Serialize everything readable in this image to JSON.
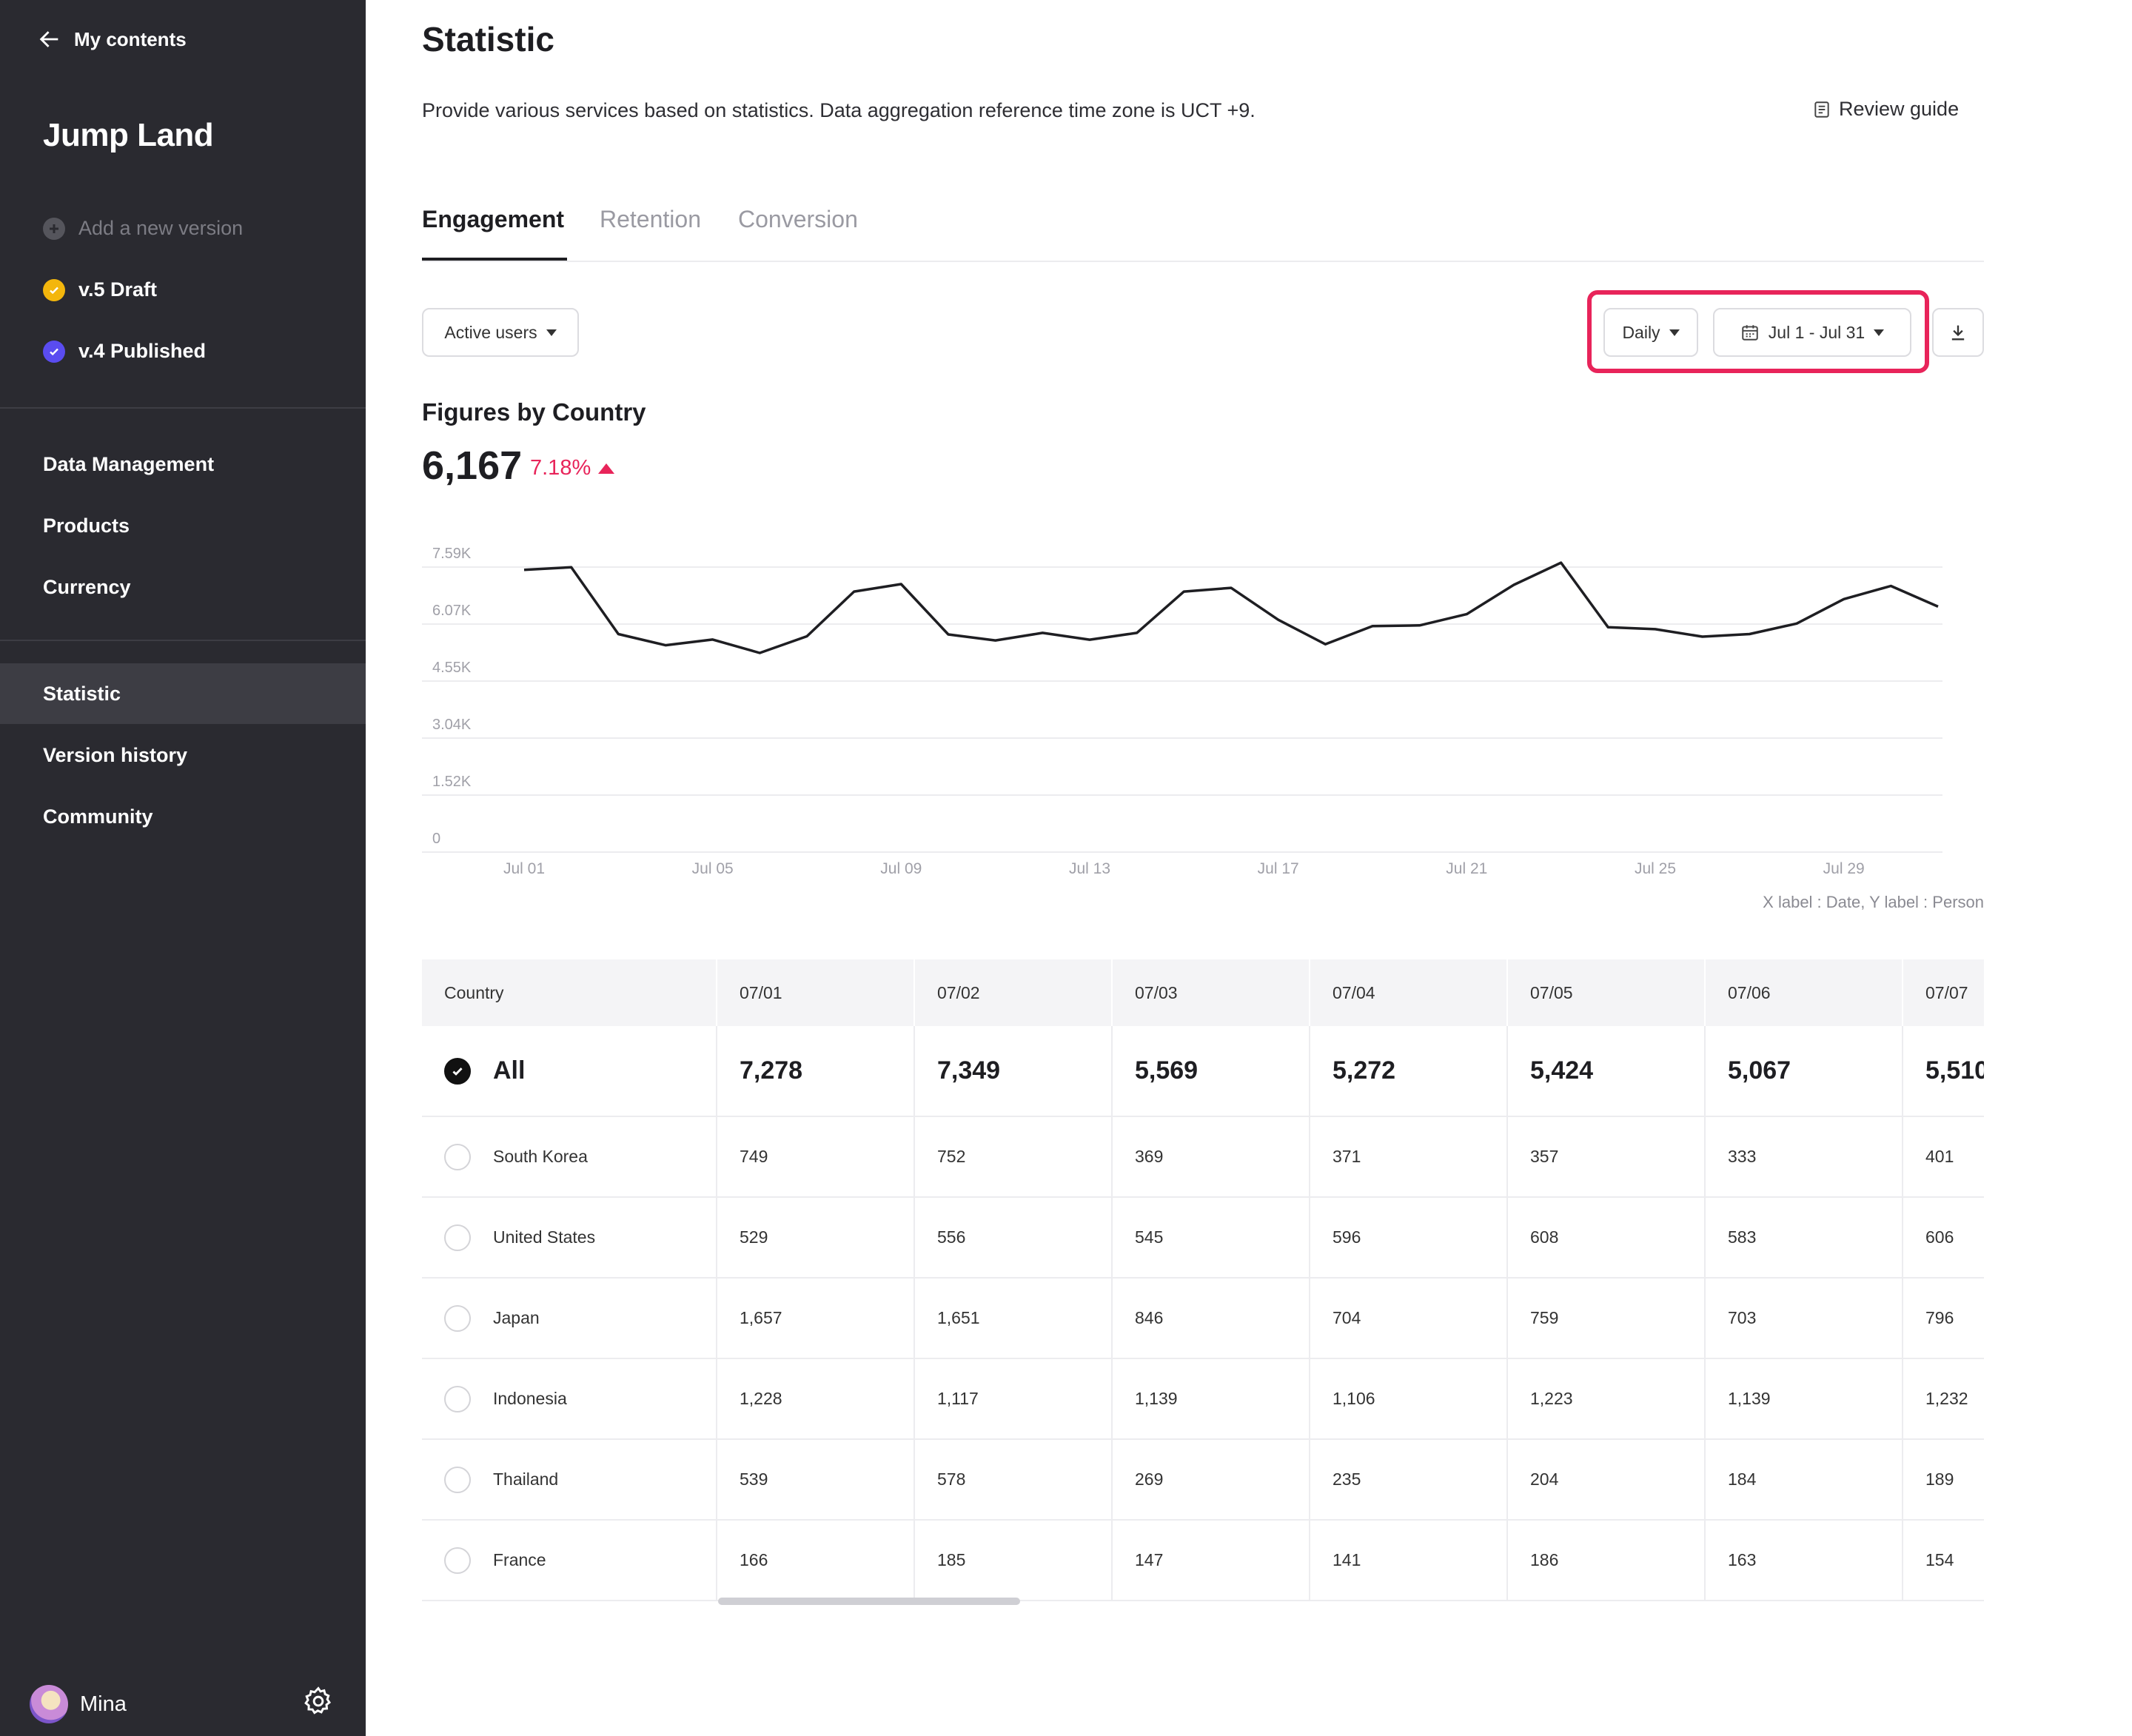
{
  "sidebar": {
    "back_label": "My contents",
    "project_title": "Jump Land",
    "versions": [
      {
        "label": "Add a new version"
      },
      {
        "label": "v.5 Draft",
        "color": "#f3b60c"
      },
      {
        "label": "v.4 Published",
        "color": "#5a4cf0"
      }
    ],
    "nav_primary": [
      {
        "label": "Data Management"
      },
      {
        "label": "Products"
      },
      {
        "label": "Currency"
      }
    ],
    "nav_secondary": [
      {
        "label": "Statistic",
        "active": true
      },
      {
        "label": "Version history"
      },
      {
        "label": "Community"
      }
    ],
    "user": {
      "name": "Mina"
    }
  },
  "header": {
    "title": "Statistic",
    "description": "Provide various services based on statistics. Data aggregation reference time zone is UCT +9.",
    "review_guide": "Review guide"
  },
  "tabs": [
    {
      "label": "Engagement",
      "active": true
    },
    {
      "label": "Retention"
    },
    {
      "label": "Conversion"
    }
  ],
  "filters": {
    "metric": "Active users",
    "granularity": "Daily",
    "date_range": "Jul 1 - Jul 31"
  },
  "summary": {
    "title": "Figures by Country",
    "total": "6,167",
    "change": "7.18%"
  },
  "chart_data": {
    "type": "line",
    "x": [
      "Jul 01",
      "Jul 02",
      "Jul 03",
      "Jul 04",
      "Jul 05",
      "Jul 06",
      "Jul 07",
      "Jul 08",
      "Jul 09",
      "Jul 10",
      "Jul 11",
      "Jul 12",
      "Jul 13",
      "Jul 14",
      "Jul 15",
      "Jul 16",
      "Jul 17",
      "Jul 18",
      "Jul 19",
      "Jul 20",
      "Jul 21",
      "Jul 22",
      "Jul 23",
      "Jul 24",
      "Jul 25",
      "Jul 26",
      "Jul 27",
      "Jul 28",
      "Jul 29",
      "Jul 30",
      "Jul 31"
    ],
    "series": [
      {
        "values": [
          7278,
          7349,
          5569,
          5272,
          5424,
          5067,
          5510,
          6700,
          6900,
          5560,
          5400,
          5600,
          5420,
          5600,
          6700,
          6800,
          5950,
          5300,
          5780,
          5800,
          6100,
          6880,
          7470,
          5750,
          5700,
          5500,
          5570,
          5850,
          6500,
          6850,
          6300
        ]
      }
    ],
    "x_tick_labels": [
      "Jul 01",
      "Jul 05",
      "Jul 09",
      "Jul 13",
      "Jul 17",
      "Jul 21",
      "Jul 25",
      "Jul 29"
    ],
    "y_tick_labels": [
      "0",
      "1.52K",
      "3.04K",
      "4.55K",
      "6.07K",
      "7.59K"
    ],
    "ylim": [
      0,
      7590
    ],
    "grid": true,
    "note": "X label : Date, Y label : Person"
  },
  "table": {
    "header_country": "Country",
    "columns": [
      "07/01",
      "07/02",
      "07/03",
      "07/04",
      "07/05",
      "07/06",
      "07/07"
    ],
    "rows": [
      {
        "country": "All",
        "checked": true,
        "values": [
          "7,278",
          "7,349",
          "5,569",
          "5,272",
          "5,424",
          "5,067",
          "5,510"
        ]
      },
      {
        "country": "South Korea",
        "values": [
          "749",
          "752",
          "369",
          "371",
          "357",
          "333",
          "401"
        ]
      },
      {
        "country": "United States",
        "values": [
          "529",
          "556",
          "545",
          "596",
          "608",
          "583",
          "606"
        ]
      },
      {
        "country": "Japan",
        "values": [
          "1,657",
          "1,651",
          "846",
          "704",
          "759",
          "703",
          "796"
        ]
      },
      {
        "country": "Indonesia",
        "values": [
          "1,228",
          "1,117",
          "1,139",
          "1,106",
          "1,223",
          "1,139",
          "1,232"
        ]
      },
      {
        "country": "Thailand",
        "values": [
          "539",
          "578",
          "269",
          "235",
          "204",
          "184",
          "189"
        ]
      },
      {
        "country": "France",
        "values": [
          "166",
          "185",
          "147",
          "141",
          "186",
          "163",
          "154"
        ]
      }
    ]
  }
}
